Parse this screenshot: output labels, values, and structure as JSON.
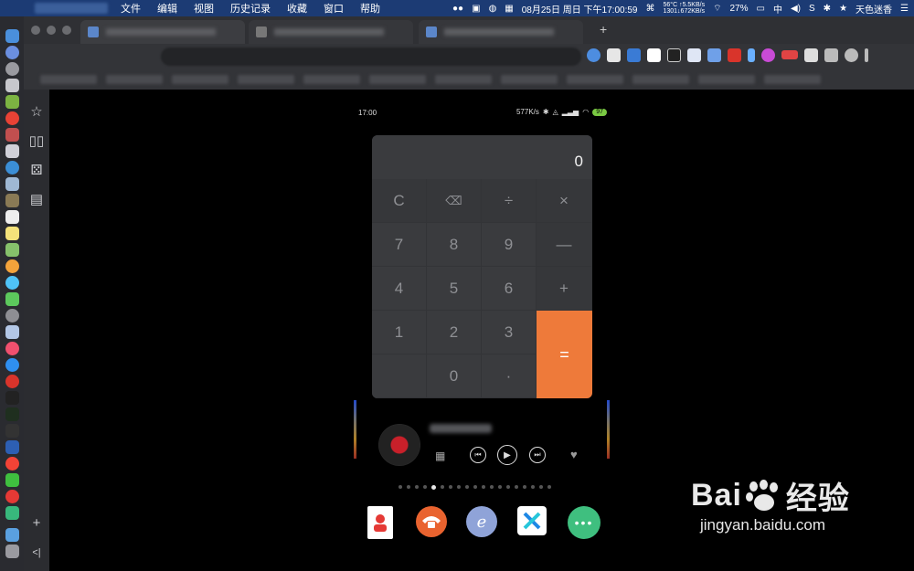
{
  "menubar": {
    "apple_icon": "apple-icon",
    "menus": [
      "文件",
      "编辑",
      "视图",
      "历史记录",
      "收藏",
      "窗口",
      "帮助"
    ],
    "net_up": "56°C ↑5.5KB/s",
    "net_down": "1301↓672KB/s",
    "date": "08月25日 周日 下午17:00:59",
    "battery": "27%",
    "input_method": "中",
    "user": "天色迷香"
  },
  "browser": {
    "new_tab": "+"
  },
  "sidebar": {
    "icons": [
      "star-icon",
      "book-icon",
      "dice-icon",
      "document-icon"
    ],
    "add": "+",
    "collapse": "<|"
  },
  "phone": {
    "status_time": "17:00",
    "network_speed": "577K/s",
    "battery": "97"
  },
  "calculator": {
    "display": "0",
    "keys": {
      "clear": "C",
      "backspace": "⌫",
      "divide": "÷",
      "multiply": "×",
      "seven": "7",
      "eight": "8",
      "nine": "9",
      "minus": "—",
      "four": "4",
      "five": "5",
      "six": "6",
      "plus": "+",
      "one": "1",
      "two": "2",
      "three": "3",
      "equals": "=",
      "zero": "0",
      "dot": "·"
    }
  },
  "music_widget": {
    "grid_icon": "grid-icon",
    "prev": "⏮",
    "play": "▶",
    "next": "⏭",
    "heart": "♥"
  },
  "page_dots": {
    "count": 19,
    "active_index": 4
  },
  "apps": [
    {
      "name": "contacts-icon",
      "color": "#ffffff"
    },
    {
      "name": "phone-icon",
      "color": "#e9632f"
    },
    {
      "name": "browser-icon",
      "color": "#8fa3d8"
    },
    {
      "name": "x-app-icon",
      "color": "#ffffff"
    },
    {
      "name": "messages-icon",
      "color": "#3fbf7f"
    }
  ],
  "watermark": {
    "brand_left": "Bai",
    "brand_right": "经验",
    "url": "jingyan.baidu.com"
  }
}
